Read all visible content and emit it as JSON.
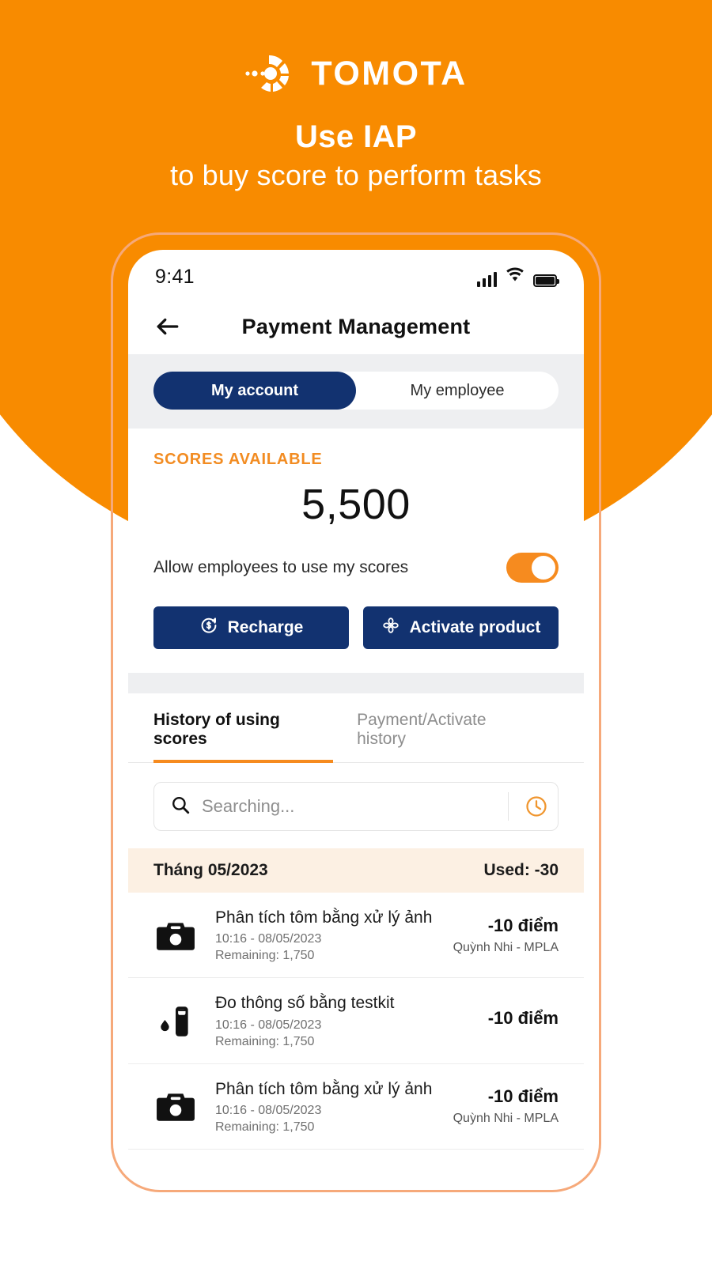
{
  "brand": {
    "logo_text": "TOMOTA",
    "logo_icon": "circular-segments-icon",
    "orange": "#F88B00",
    "navy": "#123270",
    "accent_orange": "#F68B1F"
  },
  "hero": {
    "headline_line1": "Use IAP",
    "headline_line2": "to buy score to perform tasks"
  },
  "phone": {
    "statusbar": {
      "time": "9:41",
      "signal_icon": "cellular-signal-icon",
      "wifi_icon": "wifi-icon",
      "battery_icon": "battery-full-icon"
    },
    "nav": {
      "back_icon": "arrow-left-icon",
      "title": "Payment Management"
    },
    "segmented": {
      "items": [
        {
          "label": "My account",
          "active": true
        },
        {
          "label": "My employee",
          "active": false
        }
      ]
    },
    "score": {
      "label": "SCORES AVAILABLE",
      "value": "5,500"
    },
    "toggle": {
      "label": "Allow employees to use my scores",
      "state": "on"
    },
    "actions": [
      {
        "label": "Recharge",
        "icon": "dollar-refresh-icon"
      },
      {
        "label": "Activate product",
        "icon": "pinwheel-flower-icon"
      }
    ],
    "history_tabs": [
      {
        "label": "History of using scores",
        "active": true
      },
      {
        "label": "Payment/Activate history",
        "active": false
      }
    ],
    "search": {
      "placeholder": "Searching...",
      "value": "",
      "search_icon": "search-icon",
      "history_icon": "clock-icon"
    },
    "month_group": {
      "title": "Tháng 05/2023",
      "summary": "Used: -30"
    },
    "transactions": [
      {
        "icon": "camera-icon",
        "title": "Phân tích tôm bằng xử lý ảnh",
        "datetime": "10:16 - 08/05/2023",
        "remaining": "Remaining: 1,750",
        "amount": "-10 điểm",
        "who": "Quỳnh Nhi - MPLA"
      },
      {
        "icon": "testkit-icon",
        "title": "Đo thông số bằng testkit",
        "datetime": "10:16 - 08/05/2023",
        "remaining": "Remaining: 1,750",
        "amount": "-10 điểm",
        "who": ""
      },
      {
        "icon": "camera-icon",
        "title": "Phân tích tôm bằng xử lý ảnh",
        "datetime": "10:16 - 08/05/2023",
        "remaining": "Remaining: 1,750",
        "amount": "-10 điểm",
        "who": "Quỳnh Nhi - MPLA"
      }
    ]
  }
}
